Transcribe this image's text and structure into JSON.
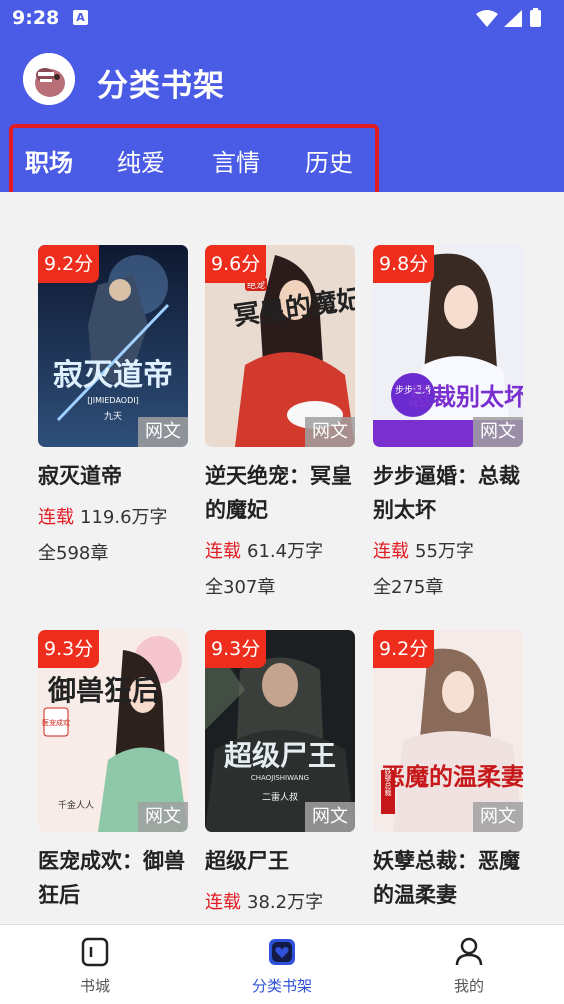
{
  "status_bar": {
    "time": "9:28",
    "notification_icon": "A"
  },
  "header": {
    "title": "分类书架"
  },
  "tabs": [
    {
      "label": "职场",
      "active": true
    },
    {
      "label": "纯爱",
      "active": false
    },
    {
      "label": "言情",
      "active": false
    },
    {
      "label": "历史",
      "active": false
    }
  ],
  "books": [
    {
      "title": "寂灭道帝",
      "score": "9.2分",
      "tag": "网文",
      "status": "连载",
      "words": "119.6万字",
      "chapters": "全598章"
    },
    {
      "title": "逆天绝宠：冥皇的魔妃",
      "score": "9.6分",
      "tag": "网文",
      "status": "连载",
      "words": "61.4万字",
      "chapters": "全307章"
    },
    {
      "title": "步步逼婚：总裁别太坏",
      "score": "9.8分",
      "tag": "网文",
      "status": "连载",
      "words": "55万字",
      "chapters": "全275章"
    },
    {
      "title": "医宠成欢：御兽狂后",
      "score": "9.3分",
      "tag": "网文",
      "status": "",
      "words": "",
      "chapters": ""
    },
    {
      "title": "超级尸王",
      "score": "9.3分",
      "tag": "网文",
      "status": "连载",
      "words": "38.2万字",
      "chapters": ""
    },
    {
      "title": "妖孽总裁：恶魔的温柔妻",
      "score": "9.2分",
      "tag": "网文",
      "status": "",
      "words": "",
      "chapters": ""
    }
  ],
  "covers": [
    {
      "text": "寂灭道帝",
      "sub": "[JIMIEDAODI]",
      "author": "九天",
      "bg": "#1d2a44"
    },
    {
      "text": "冥皇的魔妃",
      "sub": "绝宠",
      "author": "",
      "bg": "#e9d9cf"
    },
    {
      "text": "总裁别太坏",
      "sub": "步步逼婚",
      "author": "",
      "bg": "#eef0f4"
    },
    {
      "text": "御兽狂后",
      "sub": "医宠成欢",
      "author": "千金人人",
      "bg": "#f7ece8"
    },
    {
      "text": "超级尸王",
      "sub": "CHAOJISHIWANG",
      "author": "二雷人叔",
      "bg": "#1b1f22"
    },
    {
      "text": "恶魔的温柔妻",
      "sub": "妖孽总裁",
      "author": "",
      "bg": "#f4ecea"
    }
  ],
  "bottom_nav": [
    {
      "label": "书城",
      "icon": "bookstore-icon",
      "active": false
    },
    {
      "label": "分类书架",
      "icon": "bookshelf-icon",
      "active": true
    },
    {
      "label": "我的",
      "icon": "profile-icon",
      "active": false
    }
  ],
  "colors": {
    "primary": "#4a5be6",
    "score_badge": "#ee2d1c",
    "serial_status": "#e31b23",
    "nav_active": "#2f52d8"
  }
}
